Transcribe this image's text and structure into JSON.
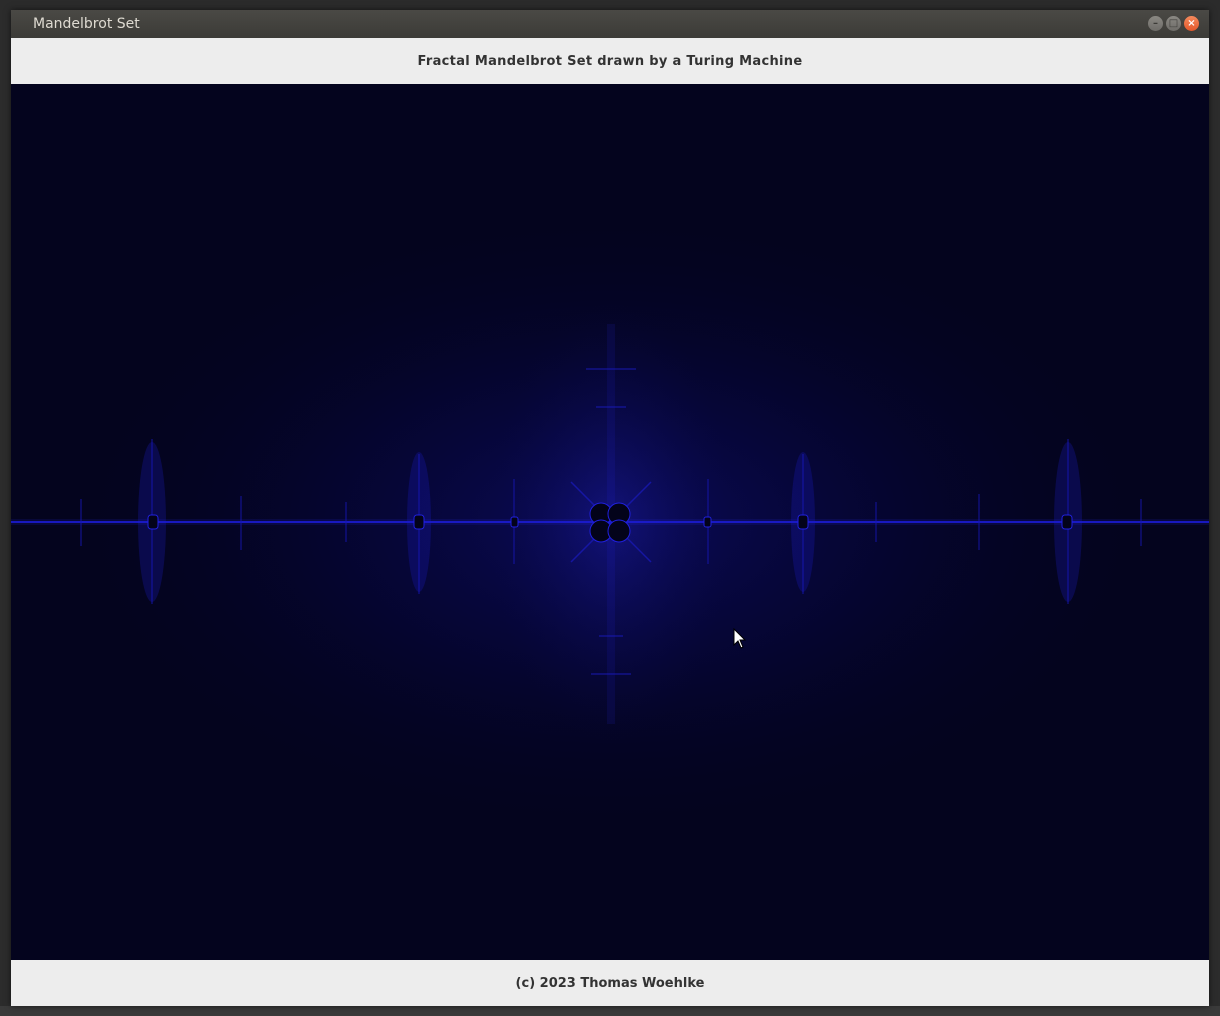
{
  "window": {
    "title": "Mandelbrot Set",
    "buttons": [
      "minimize",
      "maximize",
      "close"
    ]
  },
  "header": {
    "text": "Fractal Mandelbrot Set drawn by a Turing Machine"
  },
  "footer": {
    "text": "(c) 2023 Thomas Woehlke"
  },
  "colors": {
    "fractal_background": "#04041e",
    "fractal_glow": "#1a1ad0",
    "fractal_core": "#050520",
    "panel_background": "#ededed",
    "titlebar": "#3c3b37"
  },
  "icons": {
    "cursor": "arrow-cursor-icon"
  }
}
